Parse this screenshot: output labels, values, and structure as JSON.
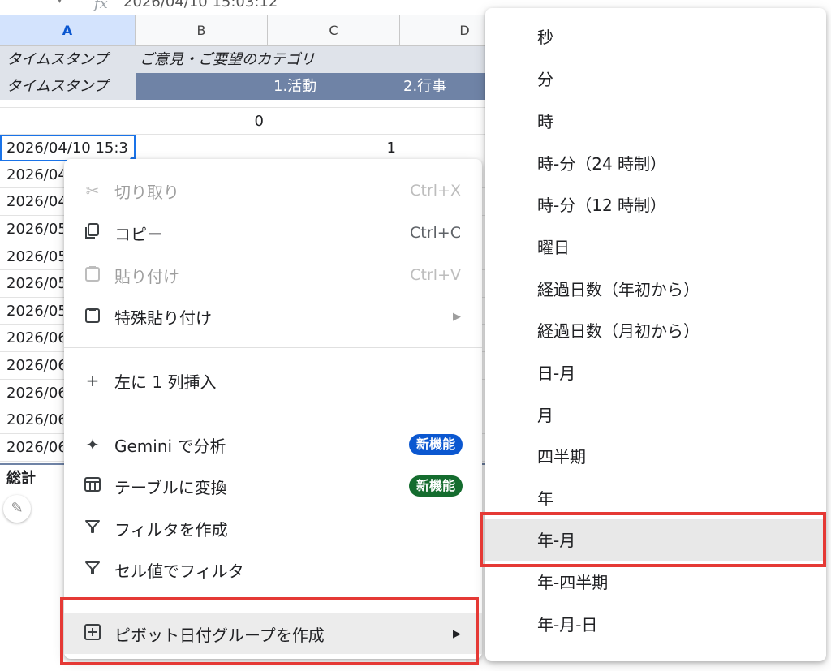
{
  "formula_bar": {
    "value": "2026/04/10 15:03:12"
  },
  "columns": [
    "A",
    "B",
    "C",
    "D"
  ],
  "rows": {
    "r1": {
      "a": "タイムスタンプ",
      "b": "ご意見・ご要望のカテゴリ"
    },
    "r2": {
      "a": "タイムスタンプ",
      "c": "1.活動",
      "d": "2.行事"
    },
    "r3": {
      "b": "0"
    },
    "r4": {
      "a": "2026/04/10 15:3",
      "c": "1"
    },
    "dates": [
      "2026/04",
      "2026/04",
      "2026/05",
      "2026/05",
      "2026/05",
      "2026/05",
      "2026/06",
      "2026/06",
      "2026/06",
      "2026/06",
      "2026/06"
    ],
    "total": "総計"
  },
  "context_menu": {
    "cut": {
      "icon": "scissors-icon",
      "label": "切り取り",
      "shortcut": "Ctrl+X"
    },
    "copy": {
      "icon": "copy-icon",
      "label": "コピー",
      "shortcut": "Ctrl+C"
    },
    "paste": {
      "icon": "clipboard-icon",
      "label": "貼り付け",
      "shortcut": "Ctrl+V"
    },
    "paste_special": {
      "icon": "clipboard-icon",
      "label": "特殊貼り付け"
    },
    "insert_left": {
      "icon": "plus-icon",
      "label": "左に 1 列挿入"
    },
    "gemini": {
      "icon": "sparkle-icon",
      "label": "Gemini で分析",
      "badge": "新機能",
      "badge_color": "#0b57d0"
    },
    "convert_table": {
      "icon": "table-icon",
      "label": "テーブルに変換",
      "badge": "新機能",
      "badge_color": "#146c2e"
    },
    "create_filter": {
      "icon": "filter-icon",
      "label": "フィルタを作成"
    },
    "filter_by_value": {
      "icon": "filter-icon",
      "label": "セル値でフィルタ"
    },
    "pivot_group": {
      "icon": "plus-box-icon",
      "label": "ピボット日付グループを作成"
    }
  },
  "submenu": [
    "秒",
    "分",
    "時",
    "時-分（24 時制）",
    "時-分（12 時制）",
    "曜日",
    "経過日数（年初から）",
    "経過日数（月初から）",
    "日-月",
    "月",
    "四半期",
    "年",
    "年-月",
    "年-四半期",
    "年-月-日"
  ],
  "highlight_color": "#e53935"
}
